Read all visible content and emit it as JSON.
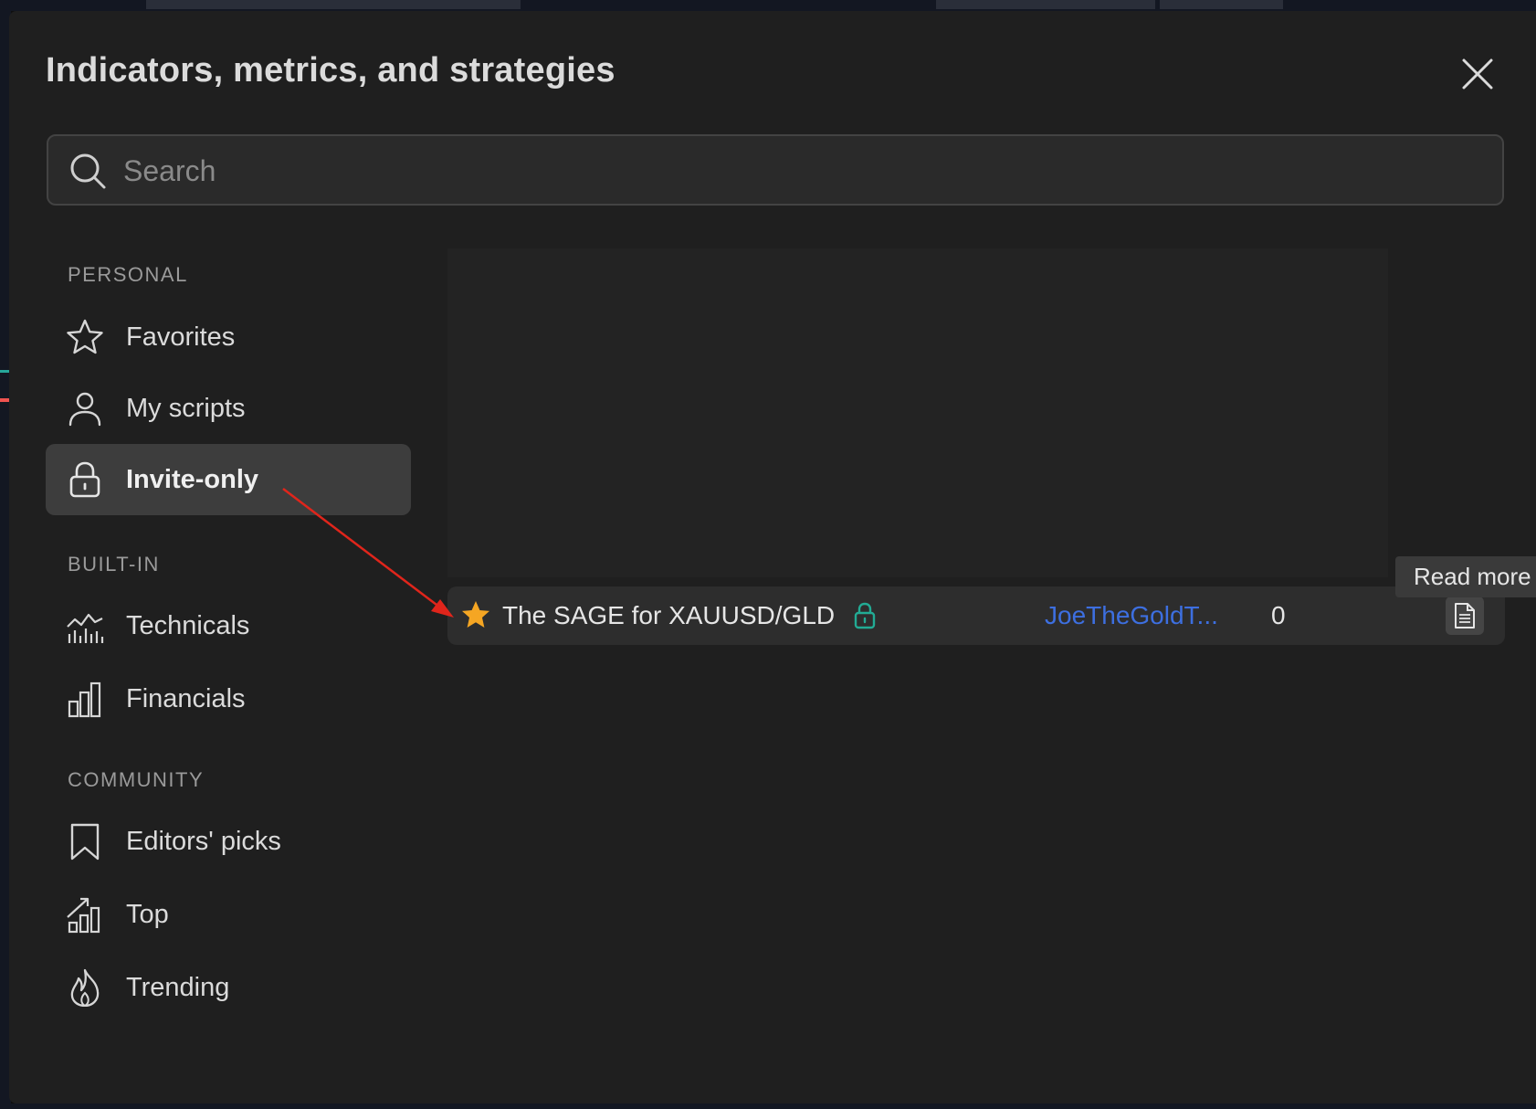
{
  "dialog": {
    "title": "Indicators, metrics, and strategies",
    "close_icon": "close-icon"
  },
  "search": {
    "placeholder": "Search",
    "value": "",
    "icon": "search-icon"
  },
  "sidebar": {
    "sections": [
      {
        "heading": "PERSONAL",
        "items": [
          {
            "label": "Favorites",
            "icon": "star-outline-icon",
            "active": false
          },
          {
            "label": "My scripts",
            "icon": "user-icon",
            "active": false
          },
          {
            "label": "Invite-only",
            "icon": "lock-icon",
            "active": true
          }
        ]
      },
      {
        "heading": "BUILT-IN",
        "items": [
          {
            "label": "Technicals",
            "icon": "technicals-chart-icon",
            "active": false
          },
          {
            "label": "Financials",
            "icon": "bar-chart-icon",
            "active": false
          }
        ]
      },
      {
        "heading": "COMMUNITY",
        "items": [
          {
            "label": "Editors' picks",
            "icon": "bookmark-icon",
            "active": false
          },
          {
            "label": "Top",
            "icon": "top-chart-icon",
            "active": false
          },
          {
            "label": "Trending",
            "icon": "flame-icon",
            "active": false
          }
        ]
      }
    ]
  },
  "results": {
    "rows": [
      {
        "favorited": true,
        "name": "The SAGE for XAUUSD/GLD",
        "invite_only": true,
        "author": "JoeTheGoldT...",
        "count": "0"
      }
    ]
  },
  "tooltip": {
    "text": "Read more"
  },
  "colors": {
    "dialog_bg": "#1f1f1f",
    "active_item_bg": "#3d3d3d",
    "star": "#f5a623",
    "lock": "#22ab94",
    "author_link": "#3d6fe0",
    "annotation_arrow": "#e0251b"
  }
}
